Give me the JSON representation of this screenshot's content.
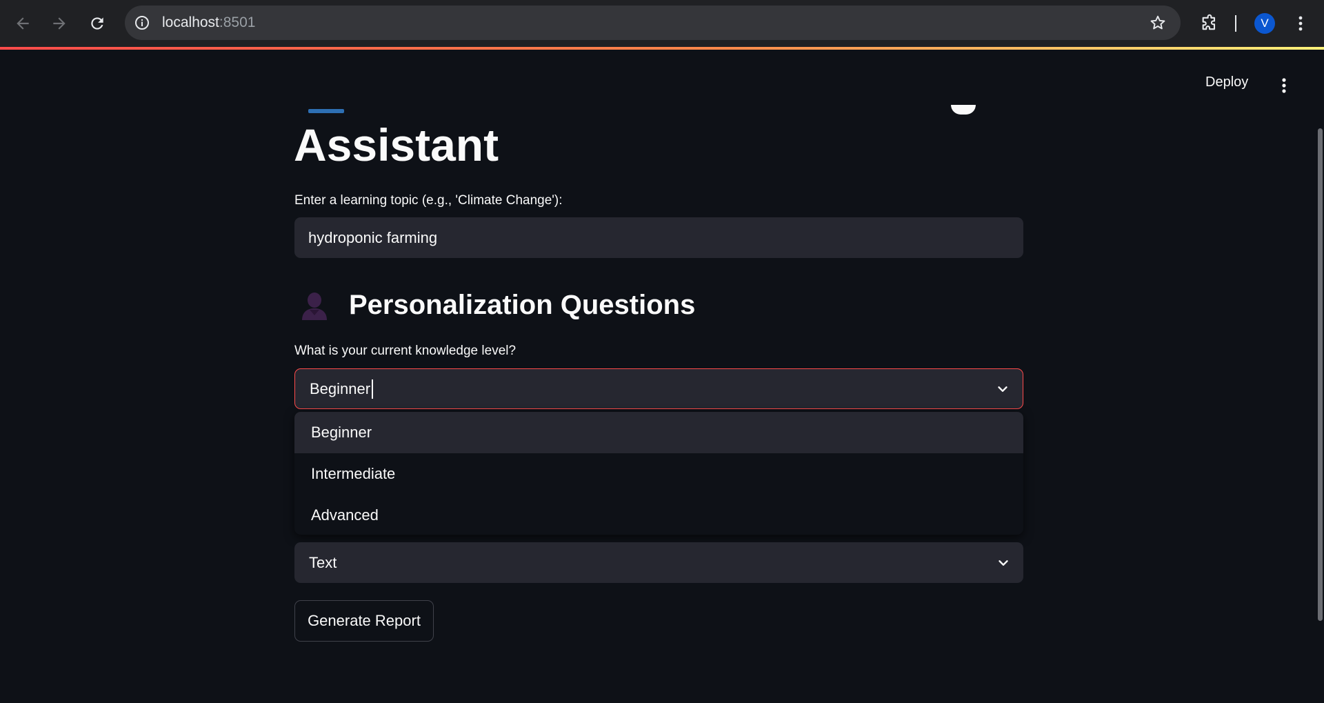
{
  "browser": {
    "url_host": "localhost",
    "url_port": ":8501",
    "profile_initial": "V",
    "icons": [
      "back-arrow-icon",
      "forward-arrow-icon",
      "reload-icon",
      "info-icon",
      "star-icon",
      "extensions-icon",
      "kebab-menu-icon"
    ]
  },
  "header": {
    "deploy_label": "Deploy",
    "menu_icon": "kebab-menu-icon"
  },
  "main": {
    "title_visible": "Assistant",
    "topic_label": "Enter a learning topic (e.g., 'Climate Change'):",
    "topic_value": "hydroponic farming",
    "section_heading": "Personalization Questions",
    "section_icon": "person-avatar-icon",
    "knowledge_label": "What is your current knowledge level?",
    "knowledge_value": "Beginner",
    "knowledge_options": [
      "Beginner",
      "Intermediate",
      "Advanced"
    ],
    "format_value": "Text",
    "generate_label": "Generate Report"
  },
  "colors": {
    "app_background": "#0e1117",
    "input_background": "#262730",
    "focus_border": "#ff4b4b",
    "profile_badge": "#0b57d0"
  }
}
